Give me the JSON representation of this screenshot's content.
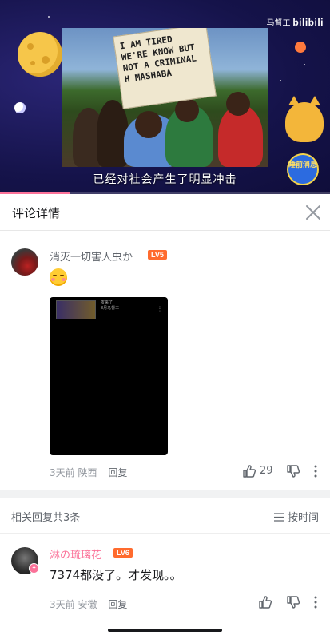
{
  "video": {
    "subtitle": "已经对社会产生了明显冲击",
    "brand_prefix": "马督工",
    "brand_name": "bilibili",
    "sign_text": "I AM TIRED WE'RE KNOW BUT NOT A CRIMINAL H MASHABA",
    "corner_badge": "睡前消息",
    "progress": 0.21
  },
  "panel": {
    "title": "评论详情"
  },
  "main_comment": {
    "username": "消灭一切害人虫か",
    "level": "LV5",
    "emoji": "blush-face",
    "screenshot_caption_1": "发来了",
    "screenshot_caption_2": "8月马督工",
    "time": "3天前",
    "location": "陕西",
    "reply_label": "回复",
    "like_count": "29"
  },
  "related": {
    "title": "相关回复共3条",
    "sort_label": "按时间"
  },
  "reply": {
    "username": "淋の琉璃花",
    "level": "LV6",
    "text": "7374都没了。才发现。。",
    "time": "3天前",
    "location": "安徽",
    "reply_label": "回复"
  },
  "colors": {
    "accent_pink": "#fb7299",
    "level_orange": "#ff6b2e",
    "video_bg": "#1c1a55"
  }
}
